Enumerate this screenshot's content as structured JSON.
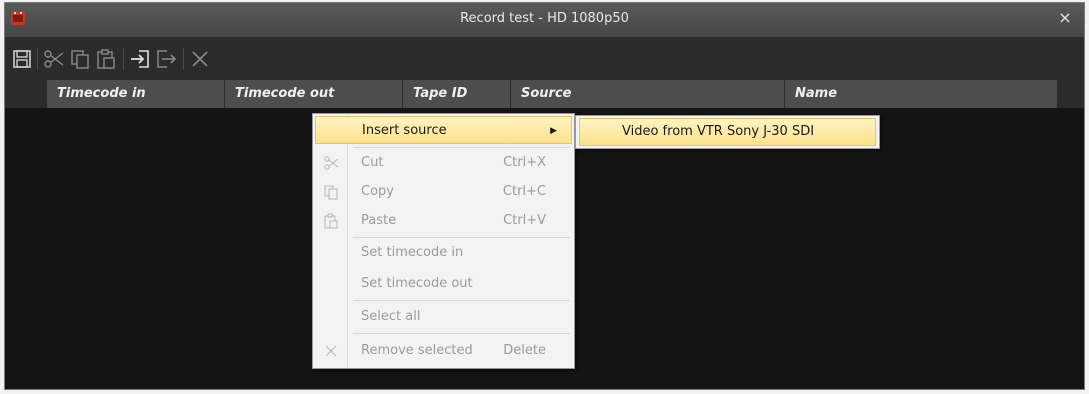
{
  "window": {
    "title": "Record test - HD 1080p50",
    "close_glyph": "×"
  },
  "toolbar": {
    "buttons": [
      {
        "icon": "save-icon"
      },
      {
        "icon": "cut-icon"
      },
      {
        "icon": "copy-icon"
      },
      {
        "icon": "paste-icon"
      },
      {
        "icon": "import-icon"
      },
      {
        "icon": "export-icon"
      },
      {
        "icon": "delete-icon"
      }
    ]
  },
  "columns": [
    "Timecode in",
    "Timecode out",
    "Tape ID",
    "Source",
    "Name"
  ],
  "context_menu": {
    "insert_source": "Insert source",
    "submenu_arrow": "▶",
    "cut": {
      "label": "Cut",
      "shortcut": "Ctrl+X"
    },
    "copy": {
      "label": "Copy",
      "shortcut": "Ctrl+C"
    },
    "paste": {
      "label": "Paste",
      "shortcut": "Ctrl+V"
    },
    "set_tc_in": "Set timecode in",
    "set_tc_out": "Set timecode out",
    "select_all": "Select all",
    "remove": {
      "label": "Remove selected",
      "shortcut": "Delete"
    }
  },
  "submenu": {
    "item": "Video from VTR Sony J-30 SDI"
  },
  "colors": {
    "highlight": "#fde28a",
    "background": "#141414",
    "header": "#4d4d4d"
  }
}
